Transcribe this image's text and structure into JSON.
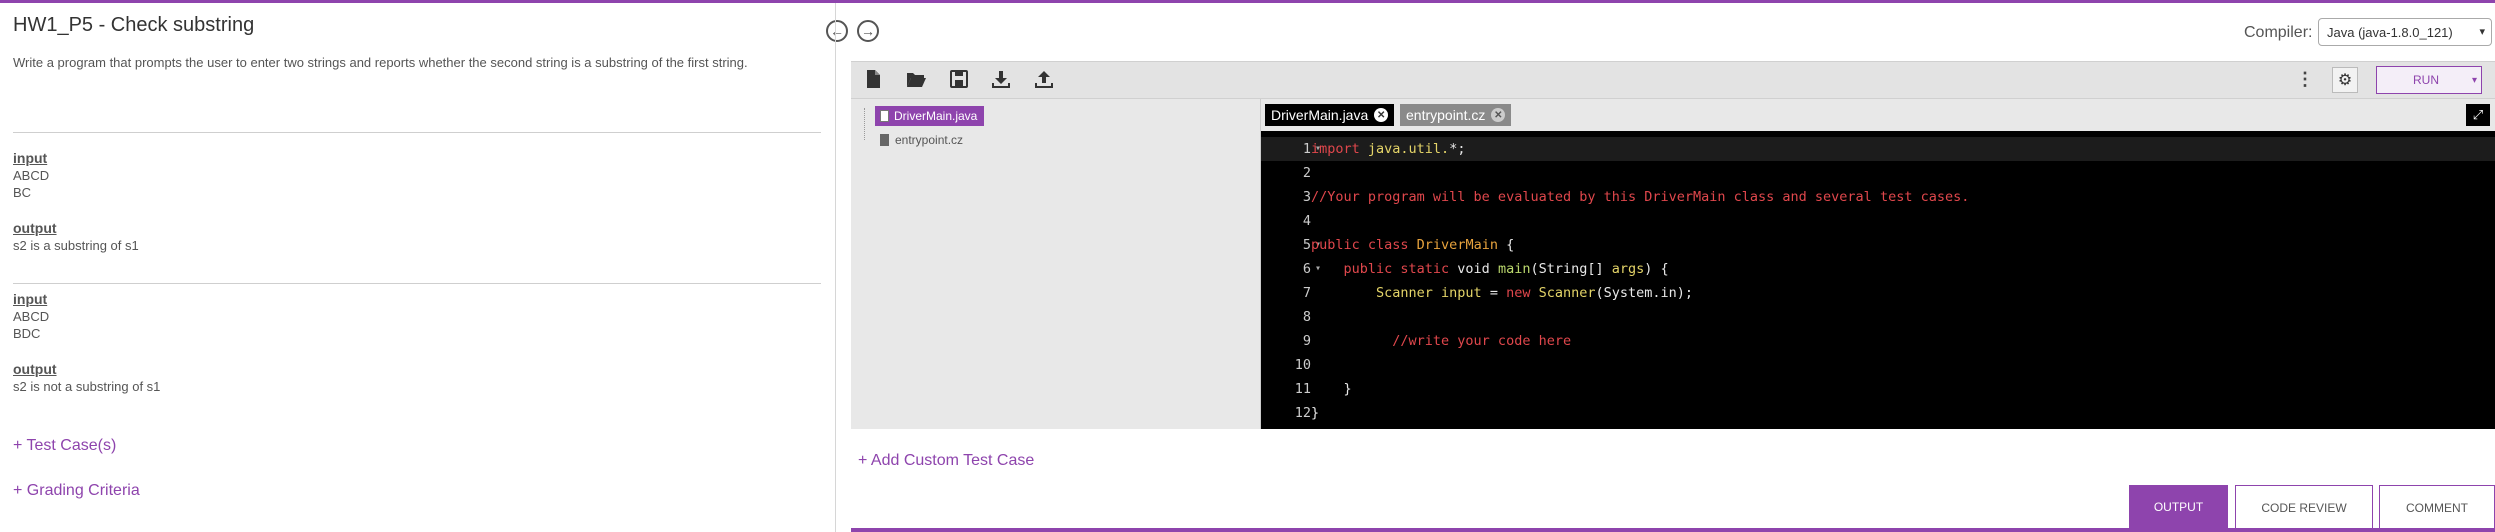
{
  "problem": {
    "title": "HW1_P5 - Check substring",
    "description": "Write a program that prompts the user to enter two strings and reports whether the second string is a substring of the first string.",
    "examples": [
      {
        "input_label": "input",
        "input_lines": [
          "ABCD",
          "BC"
        ],
        "output_label": "output",
        "output_lines": [
          "s2 is a substring of s1"
        ]
      },
      {
        "input_label": "input",
        "input_lines": [
          "ABCD",
          "BDC"
        ],
        "output_label": "output",
        "output_lines": [
          "s2 is not a substring of s1"
        ]
      }
    ],
    "test_cases_link": "+ Test Case(s)",
    "grading_link": "+ Grading Criteria"
  },
  "compiler": {
    "label": "Compiler:",
    "selected": "Java (java-1.8.0_121)"
  },
  "toolbar": {
    "icons": [
      "new-file-icon",
      "open-folder-icon",
      "save-icon",
      "download-icon",
      "upload-icon"
    ],
    "more": "⋮",
    "settings": "⚙",
    "run_label": "RUN",
    "run_dropdown": "▾"
  },
  "files": {
    "active": "DriverMain.java",
    "other": "entrypoint.cz"
  },
  "editor_tabs": [
    {
      "label": "DriverMain.java",
      "close": "✕"
    },
    {
      "label": "entrypoint.cz",
      "close": "✕"
    }
  ],
  "expand_icon": "⤢",
  "code_lines": [
    {
      "n": "1",
      "fold": "▾"
    },
    {
      "n": "2",
      "fold": ""
    },
    {
      "n": "3",
      "fold": ""
    },
    {
      "n": "4",
      "fold": ""
    },
    {
      "n": "5",
      "fold": "▾"
    },
    {
      "n": "6",
      "fold": "▾"
    },
    {
      "n": "7",
      "fold": ""
    },
    {
      "n": "8",
      "fold": ""
    },
    {
      "n": "9",
      "fold": ""
    },
    {
      "n": "10",
      "fold": ""
    },
    {
      "n": "11",
      "fold": ""
    },
    {
      "n": "12",
      "fold": ""
    }
  ],
  "code": {
    "l1_kw": "import",
    "l1_pkg": " java.util.",
    "l1_rest": "*;",
    "l3": "//Your program will be evaluated by this DriverMain class and several test cases.",
    "l5_kw": "public class",
    "l5_cls": " DriverMain",
    "l5_rest": " {",
    "l6_kw": "    public static",
    "l6_void": " void",
    "l6_main": " main",
    "l6_p1": "(String[]",
    "l6_args": " args",
    "l6_p2": ") {",
    "l7_type": "        Scanner",
    "l7_var": " input",
    "l7_eq": " =",
    "l7_new": " new",
    "l7_cls": " Scanner",
    "l7_rest": "(System.in);",
    "l9": "          //write your code here",
    "l11": "    }",
    "l12": "}"
  },
  "add_custom_test": "+ Add Custom Test Case",
  "bottom_tabs": {
    "output": "OUTPUT",
    "code_review": "CODE REVIEW",
    "comment": "COMMENT"
  },
  "colors": {
    "accent": "#8e44ad",
    "editor_bg": "#000000"
  }
}
